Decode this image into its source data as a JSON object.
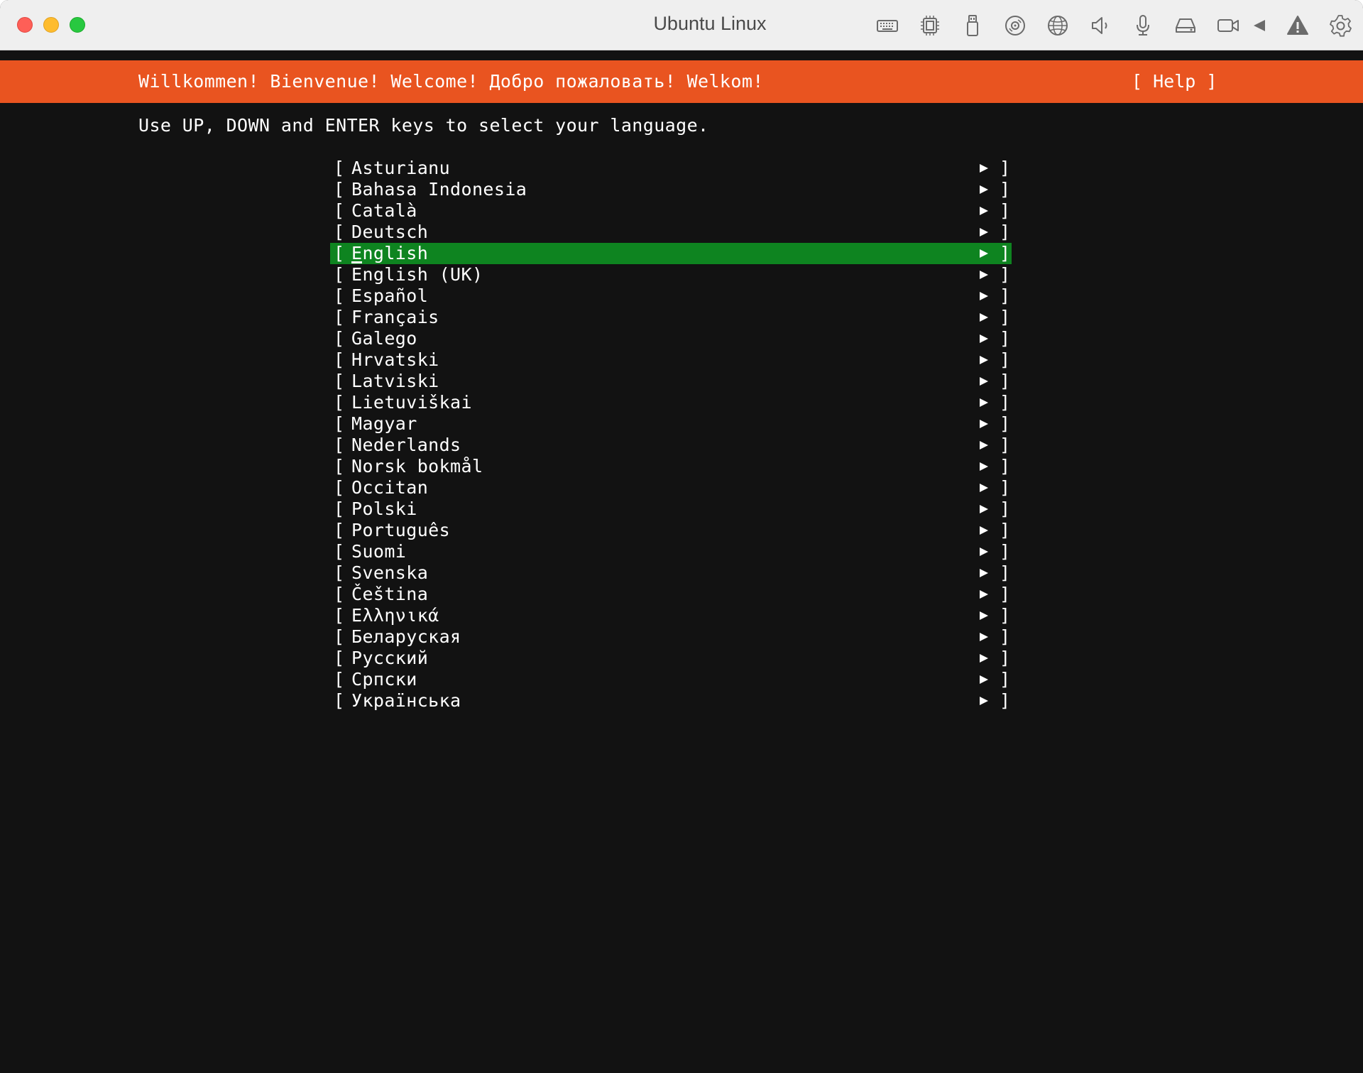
{
  "window": {
    "title": "Ubuntu Linux",
    "toolbar_icons": [
      "keyboard-icon",
      "cpu-icon",
      "usb-icon",
      "disc-icon",
      "network-icon",
      "speaker-icon",
      "microphone-icon",
      "drive-icon",
      "camera-icon",
      "back-icon",
      "warning-icon",
      "settings-icon"
    ]
  },
  "installer": {
    "header": {
      "welcome": "Willkommen! Bienvenue! Welcome! Добро пожаловать! Welkom!",
      "help": "[ Help ]"
    },
    "instruction": "Use UP, DOWN and ENTER keys to select your language.",
    "selected_index": 4,
    "bracket_left": "[",
    "bracket_right": "]",
    "languages": [
      {
        "label": "Asturianu"
      },
      {
        "label": "Bahasa Indonesia"
      },
      {
        "label": "Català"
      },
      {
        "label": "Deutsch"
      },
      {
        "label": "English"
      },
      {
        "label": "English (UK)"
      },
      {
        "label": "Español"
      },
      {
        "label": "Français"
      },
      {
        "label": "Galego"
      },
      {
        "label": "Hrvatski"
      },
      {
        "label": "Latviski"
      },
      {
        "label": "Lietuviškai"
      },
      {
        "label": "Magyar"
      },
      {
        "label": "Nederlands"
      },
      {
        "label": "Norsk bokmål"
      },
      {
        "label": "Occitan"
      },
      {
        "label": "Polski"
      },
      {
        "label": "Português"
      },
      {
        "label": "Suomi"
      },
      {
        "label": "Svenska"
      },
      {
        "label": "Čeština"
      },
      {
        "label": "Ελληνικά"
      },
      {
        "label": "Беларуская"
      },
      {
        "label": "Русский"
      },
      {
        "label": "Српски"
      },
      {
        "label": "Українська"
      }
    ]
  },
  "colors": {
    "header_bg": "#e95420",
    "selected_bg": "#0e8420",
    "terminal_bg": "#121212"
  }
}
